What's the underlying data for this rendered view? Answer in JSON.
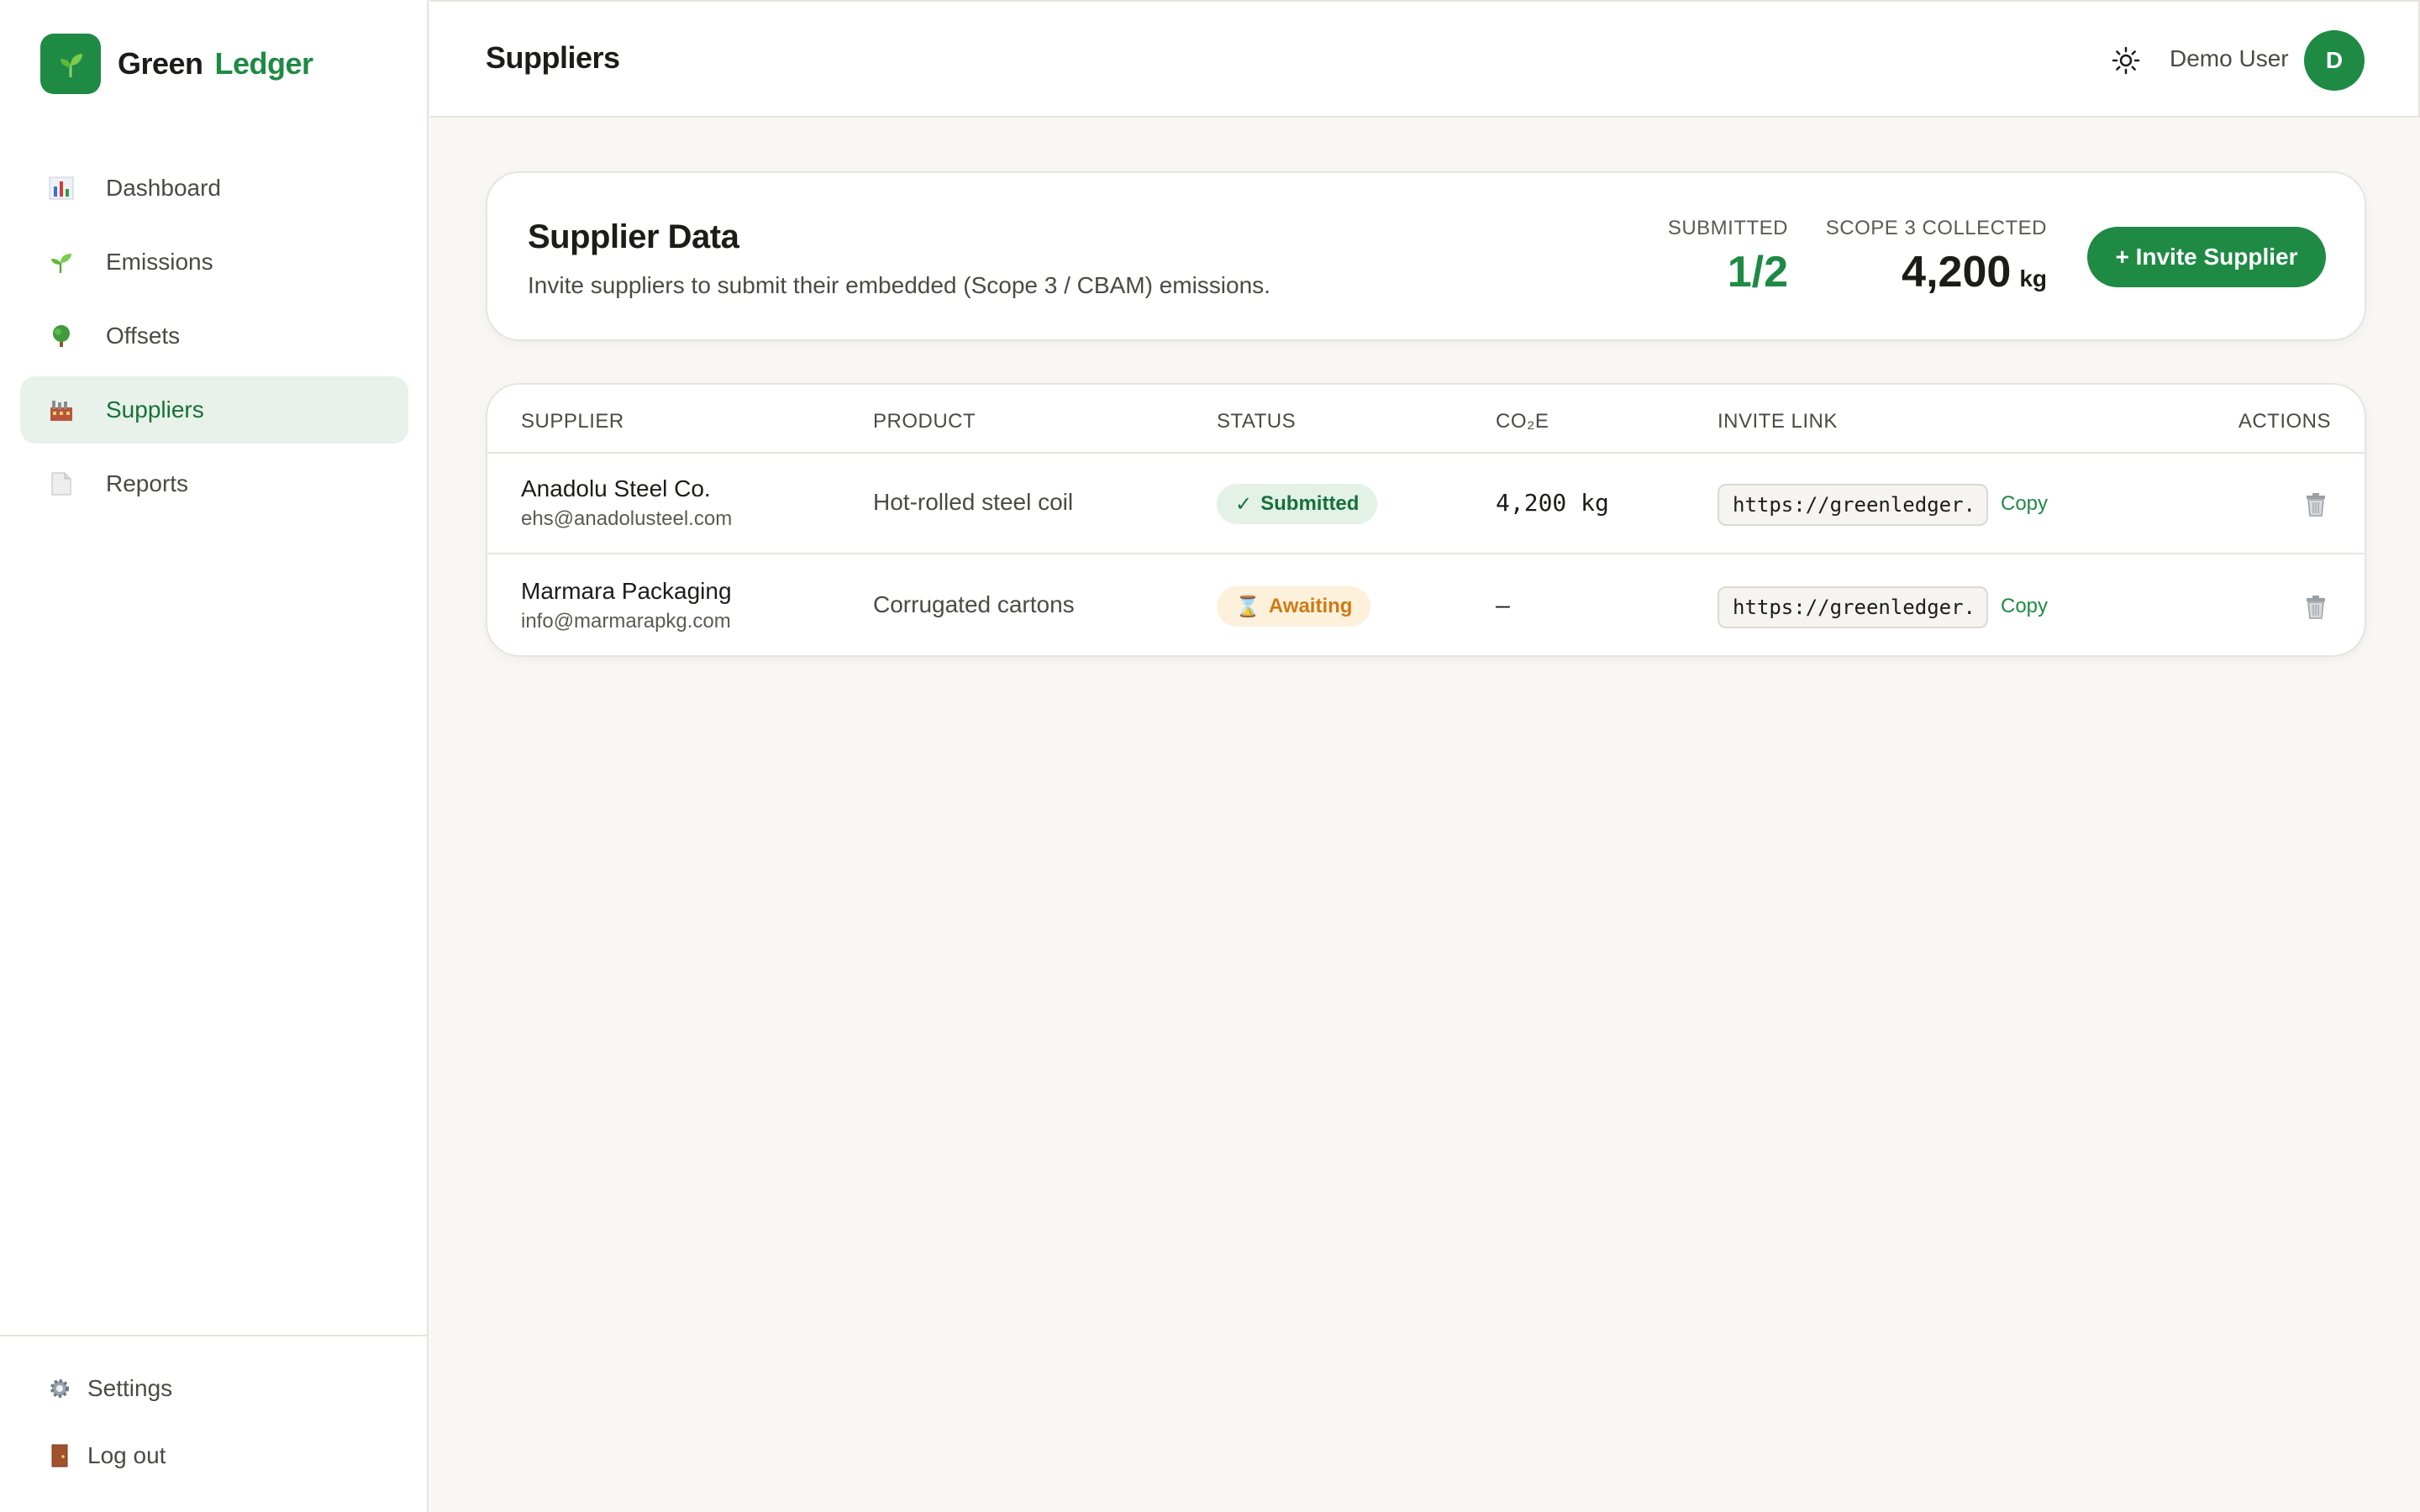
{
  "brand": {
    "word1": "Green",
    "word2": "Ledger"
  },
  "sidebar": {
    "items": [
      {
        "label": "Dashboard",
        "icon": "bar-chart-icon",
        "active": false
      },
      {
        "label": "Emissions",
        "icon": "seedling-icon",
        "active": false
      },
      {
        "label": "Offsets",
        "icon": "tree-icon",
        "active": false
      },
      {
        "label": "Suppliers",
        "icon": "factory-icon",
        "active": true
      },
      {
        "label": "Reports",
        "icon": "document-icon",
        "active": false
      }
    ],
    "bottom": [
      {
        "label": "Settings",
        "icon": "gear-icon"
      },
      {
        "label": "Log out",
        "icon": "door-icon"
      }
    ]
  },
  "header": {
    "title": "Suppliers",
    "user_name": "Demo User",
    "avatar_initial": "D"
  },
  "summary": {
    "title": "Supplier Data",
    "subtitle": "Invite suppliers to submit their embedded (Scope 3 / CBAM) emissions.",
    "submitted_label": "SUBMITTED",
    "submitted_value": "1/2",
    "collected_label": "SCOPE 3 COLLECTED",
    "collected_value": "4,200",
    "collected_unit": "kg",
    "invite_button": "+ Invite Supplier"
  },
  "table": {
    "headers": [
      "SUPPLIER",
      "PRODUCT",
      "STATUS",
      "CO₂E",
      "INVITE LINK",
      "ACTIONS"
    ],
    "rows": [
      {
        "supplier": "Anadolu Steel Co.",
        "email": "ehs@anadolusteel.com",
        "product": "Hot-rolled steel coil",
        "status": "Submitted",
        "status_icon": "✓",
        "co2e": "4,200 kg",
        "invite_link": "https://greenledger.",
        "copy_label": "Copy"
      },
      {
        "supplier": "Marmara Packaging",
        "email": "info@marmarapkg.com",
        "product": "Corrugated cartons",
        "status": "Awaiting",
        "status_icon": "⌛",
        "co2e": "—",
        "invite_link": "https://greenledger.",
        "copy_label": "Copy"
      }
    ]
  },
  "colors": {
    "accent": "#1e8a44",
    "active_bg": "#e8f1ea",
    "warning": "#d07a14",
    "background": "#f8f7f3"
  }
}
